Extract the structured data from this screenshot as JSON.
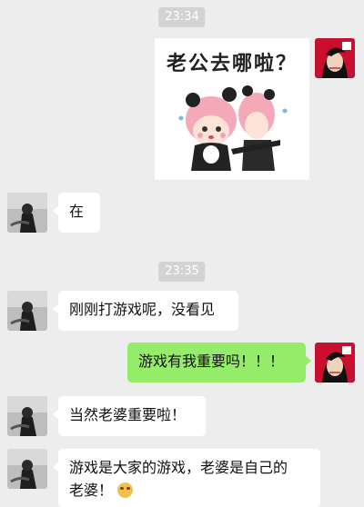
{
  "timestamps": [
    "23:34",
    "23:35"
  ],
  "sticker": {
    "text": "老公去哪啦？"
  },
  "messages": [
    {
      "text": "在"
    },
    {
      "text": "刚刚打游戏呢，没看见"
    },
    {
      "text": "游戏有我重要吗！！！"
    },
    {
      "text": "当然老婆重要啦！"
    },
    {
      "line1": "游戏是大家的游戏，老婆是自己的",
      "line2": "老婆！"
    }
  ],
  "colors": {
    "background": "#ededed",
    "incoming_bubble": "#ffffff",
    "outgoing_bubble": "#95ec69",
    "timestamp_bg": "#d3d3d3"
  },
  "icons": {
    "self_avatar": "self-avatar",
    "partner_avatar": "partner-avatar",
    "emoji": "smile-emoji-icon"
  }
}
